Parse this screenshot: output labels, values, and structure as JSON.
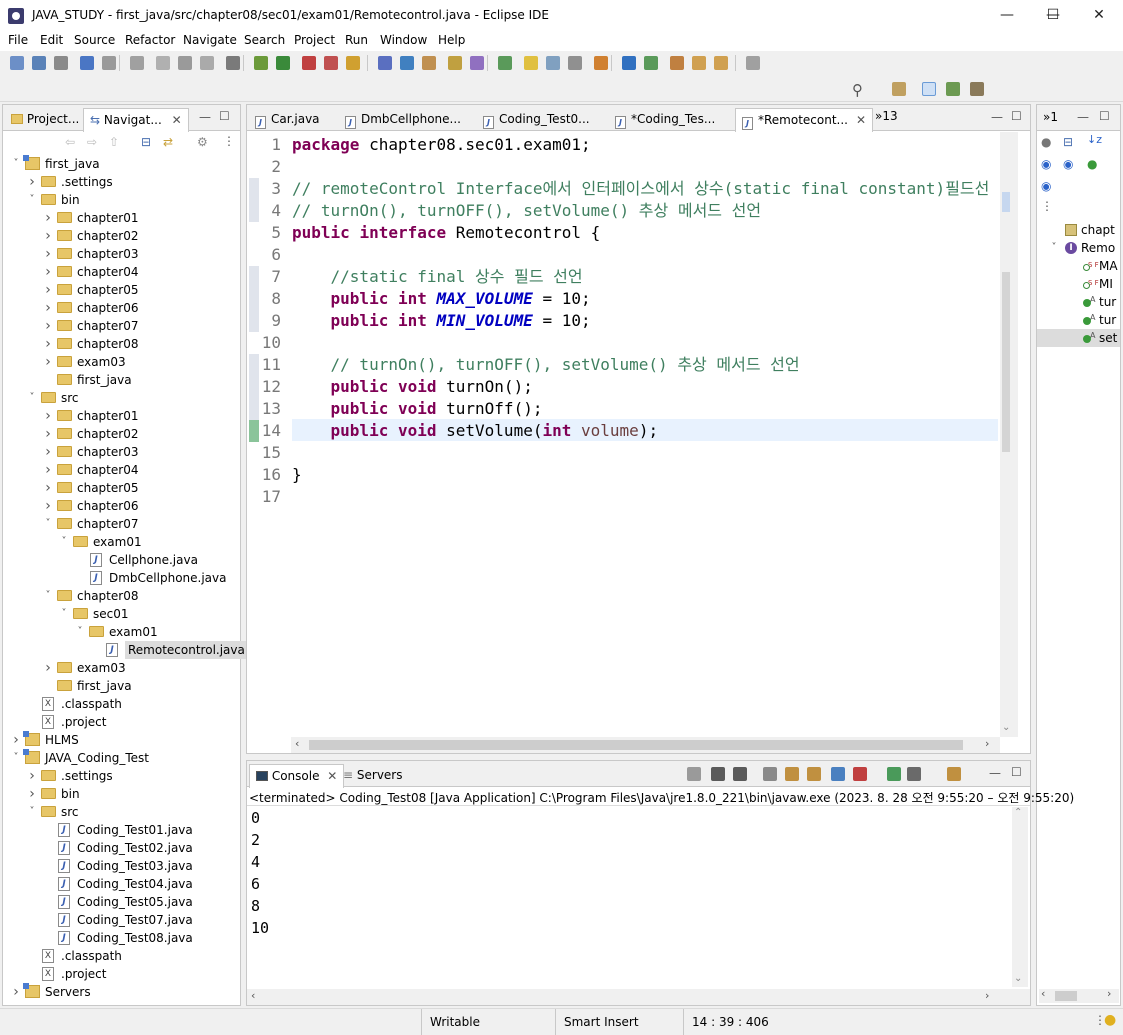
{
  "window": {
    "title": "JAVA_STUDY - first_java/src/chapter08/sec01/exam01/Remotecontrol.java - Eclipse IDE"
  },
  "menu": [
    "File",
    "Edit",
    "Source",
    "Refactor",
    "Navigate",
    "Search",
    "Project",
    "Run",
    "Window",
    "Help"
  ],
  "left_tabs": {
    "project": "Project...",
    "navigator": "Navigat..."
  },
  "tree": [
    {
      "depth": 0,
      "type": "proj",
      "open": true,
      "label": "first_java"
    },
    {
      "depth": 1,
      "type": "folder",
      "open": false,
      "label": ".settings"
    },
    {
      "depth": 1,
      "type": "folder",
      "open": true,
      "label": "bin"
    },
    {
      "depth": 2,
      "type": "folder",
      "open": false,
      "label": "chapter01"
    },
    {
      "depth": 2,
      "type": "folder",
      "open": false,
      "label": "chapter02"
    },
    {
      "depth": 2,
      "type": "folder",
      "open": false,
      "label": "chapter03"
    },
    {
      "depth": 2,
      "type": "folder",
      "open": false,
      "label": "chapter04"
    },
    {
      "depth": 2,
      "type": "folder",
      "open": false,
      "label": "chapter05"
    },
    {
      "depth": 2,
      "type": "folder",
      "open": false,
      "label": "chapter06"
    },
    {
      "depth": 2,
      "type": "folder",
      "open": false,
      "label": "chapter07"
    },
    {
      "depth": 2,
      "type": "folder",
      "open": false,
      "label": "chapter08"
    },
    {
      "depth": 2,
      "type": "folder",
      "open": false,
      "label": "exam03"
    },
    {
      "depth": 2,
      "type": "folder",
      "open": null,
      "label": "first_java"
    },
    {
      "depth": 1,
      "type": "folder",
      "open": true,
      "label": "src"
    },
    {
      "depth": 2,
      "type": "folder",
      "open": false,
      "label": "chapter01"
    },
    {
      "depth": 2,
      "type": "folder",
      "open": false,
      "label": "chapter02"
    },
    {
      "depth": 2,
      "type": "folder",
      "open": false,
      "label": "chapter03"
    },
    {
      "depth": 2,
      "type": "folder",
      "open": false,
      "label": "chapter04"
    },
    {
      "depth": 2,
      "type": "folder",
      "open": false,
      "label": "chapter05"
    },
    {
      "depth": 2,
      "type": "folder",
      "open": false,
      "label": "chapter06"
    },
    {
      "depth": 2,
      "type": "folder",
      "open": true,
      "label": "chapter07"
    },
    {
      "depth": 3,
      "type": "folder",
      "open": true,
      "label": "exam01"
    },
    {
      "depth": 4,
      "type": "java",
      "open": null,
      "label": "Cellphone.java"
    },
    {
      "depth": 4,
      "type": "java",
      "open": null,
      "label": "DmbCellphone.java"
    },
    {
      "depth": 2,
      "type": "folder",
      "open": true,
      "label": "chapter08"
    },
    {
      "depth": 3,
      "type": "folder",
      "open": true,
      "label": "sec01"
    },
    {
      "depth": 4,
      "type": "folder",
      "open": true,
      "label": "exam01"
    },
    {
      "depth": 5,
      "type": "java",
      "open": null,
      "label": "Remotecontrol.java",
      "selected": true
    },
    {
      "depth": 2,
      "type": "folder",
      "open": false,
      "label": "exam03"
    },
    {
      "depth": 2,
      "type": "folder",
      "open": null,
      "label": "first_java"
    },
    {
      "depth": 1,
      "type": "xml",
      "open": null,
      "label": ".classpath"
    },
    {
      "depth": 1,
      "type": "xml",
      "open": null,
      "label": ".project"
    },
    {
      "depth": 0,
      "type": "proj",
      "open": false,
      "label": "HLMS"
    },
    {
      "depth": 0,
      "type": "proj",
      "open": true,
      "label": "JAVA_Coding_Test"
    },
    {
      "depth": 1,
      "type": "folder",
      "open": false,
      "label": ".settings"
    },
    {
      "depth": 1,
      "type": "folder",
      "open": false,
      "label": "bin"
    },
    {
      "depth": 1,
      "type": "folder",
      "open": true,
      "label": "src"
    },
    {
      "depth": 2,
      "type": "java",
      "open": null,
      "label": "Coding_Test01.java"
    },
    {
      "depth": 2,
      "type": "java",
      "open": null,
      "label": "Coding_Test02.java"
    },
    {
      "depth": 2,
      "type": "java",
      "open": null,
      "label": "Coding_Test03.java"
    },
    {
      "depth": 2,
      "type": "java",
      "open": null,
      "label": "Coding_Test04.java"
    },
    {
      "depth": 2,
      "type": "java",
      "open": null,
      "label": "Coding_Test05.java"
    },
    {
      "depth": 2,
      "type": "java",
      "open": null,
      "label": "Coding_Test07.java"
    },
    {
      "depth": 2,
      "type": "java",
      "open": null,
      "label": "Coding_Test08.java"
    },
    {
      "depth": 1,
      "type": "xml",
      "open": null,
      "label": ".classpath"
    },
    {
      "depth": 1,
      "type": "xml",
      "open": null,
      "label": ".project"
    },
    {
      "depth": 0,
      "type": "proj",
      "open": false,
      "label": "Servers"
    }
  ],
  "editor_tabs": [
    {
      "label": "Car.java",
      "active": false
    },
    {
      "label": "DmbCellphone...",
      "active": false
    },
    {
      "label": "Coding_Test0...",
      "active": false
    },
    {
      "label": "*Coding_Tes...",
      "active": false
    },
    {
      "label": "*Remotecont...",
      "active": true
    }
  ],
  "editor_overflow": "»13",
  "outline_overflow": "»1",
  "code": [
    [
      {
        "t": "package",
        "c": "kw"
      },
      {
        "t": " chapter08.sec01.exam01;"
      }
    ],
    [],
    [
      {
        "t": "// remoteControl Interface에서 인터페이스에서 상수(static final constant)필드선",
        "c": "cm"
      }
    ],
    [
      {
        "t": "// turnOn(), turnOFF(), setVolume() 추상 메서드 선언",
        "c": "cm"
      }
    ],
    [
      {
        "t": "public",
        "c": "kw"
      },
      {
        "t": " "
      },
      {
        "t": "interface",
        "c": "kw"
      },
      {
        "t": " Remotecontrol {"
      }
    ],
    [],
    [
      {
        "t": "    "
      },
      {
        "t": "//static final 상수 필드 선언",
        "c": "cm"
      }
    ],
    [
      {
        "t": "    "
      },
      {
        "t": "public",
        "c": "kw"
      },
      {
        "t": " "
      },
      {
        "t": "int",
        "c": "kw"
      },
      {
        "t": " "
      },
      {
        "t": "MAX_VOLUME",
        "c": "fld"
      },
      {
        "t": " = 10;"
      }
    ],
    [
      {
        "t": "    "
      },
      {
        "t": "public",
        "c": "kw"
      },
      {
        "t": " "
      },
      {
        "t": "int",
        "c": "kw"
      },
      {
        "t": " "
      },
      {
        "t": "MIN_VOLUME",
        "c": "fld"
      },
      {
        "t": " = 10;"
      }
    ],
    [],
    [
      {
        "t": "    "
      },
      {
        "t": "// turnOn(), turnOFF(), setVolume() 추상 메서드 선언",
        "c": "cm"
      }
    ],
    [
      {
        "t": "    "
      },
      {
        "t": "public",
        "c": "kw"
      },
      {
        "t": " "
      },
      {
        "t": "void",
        "c": "kw"
      },
      {
        "t": " turnOn();"
      }
    ],
    [
      {
        "t": "    "
      },
      {
        "t": "public",
        "c": "kw"
      },
      {
        "t": " "
      },
      {
        "t": "void",
        "c": "kw"
      },
      {
        "t": " turnOff();"
      }
    ],
    [
      {
        "t": "    "
      },
      {
        "t": "public",
        "c": "kw"
      },
      {
        "t": " "
      },
      {
        "t": "void",
        "c": "kw"
      },
      {
        "t": " setVolume("
      },
      {
        "t": "int",
        "c": "kw"
      },
      {
        "t": " "
      },
      {
        "t": "volume",
        "c": "param"
      },
      {
        "t": ");"
      }
    ],
    [],
    [
      {
        "t": "}"
      }
    ],
    []
  ],
  "line_numbers": [
    "1",
    "2",
    "3",
    "4",
    "5",
    "6",
    "7",
    "8",
    "9",
    "10",
    "11",
    "12",
    "13",
    "14",
    "15",
    "16",
    "17"
  ],
  "current_line": 14,
  "outline": {
    "items": [
      {
        "label": "chapt",
        "kind": "package"
      },
      {
        "label": "Remo",
        "kind": "interface"
      },
      {
        "label": "MA",
        "kind": "sf"
      },
      {
        "label": "MI",
        "kind": "sf"
      },
      {
        "label": "tur",
        "kind": "method"
      },
      {
        "label": "tur",
        "kind": "method"
      },
      {
        "label": "set",
        "kind": "method"
      }
    ],
    "sf_badge": "S F",
    "abstract_badge": "A"
  },
  "console": {
    "tab_label": "Console",
    "servers_label": "Servers",
    "header": "<terminated> Coding_Test08 [Java Application] C:\\Program Files\\Java\\jre1.8.0_221\\bin\\javaw.exe  (2023. 8. 28 오전 9:55:20 – 오전 9:55:20)",
    "output": [
      "0",
      "2",
      "4",
      "6",
      "8",
      "10"
    ]
  },
  "status": {
    "writable": "Writable",
    "insert_mode": "Smart Insert",
    "position": "14 : 39 : 406"
  },
  "colors": {
    "keyword": "#7f0055",
    "comment": "#3f7f5f",
    "field": "#0000c0",
    "current_line": "#e8f2fe",
    "selection": "#cce8ff"
  }
}
